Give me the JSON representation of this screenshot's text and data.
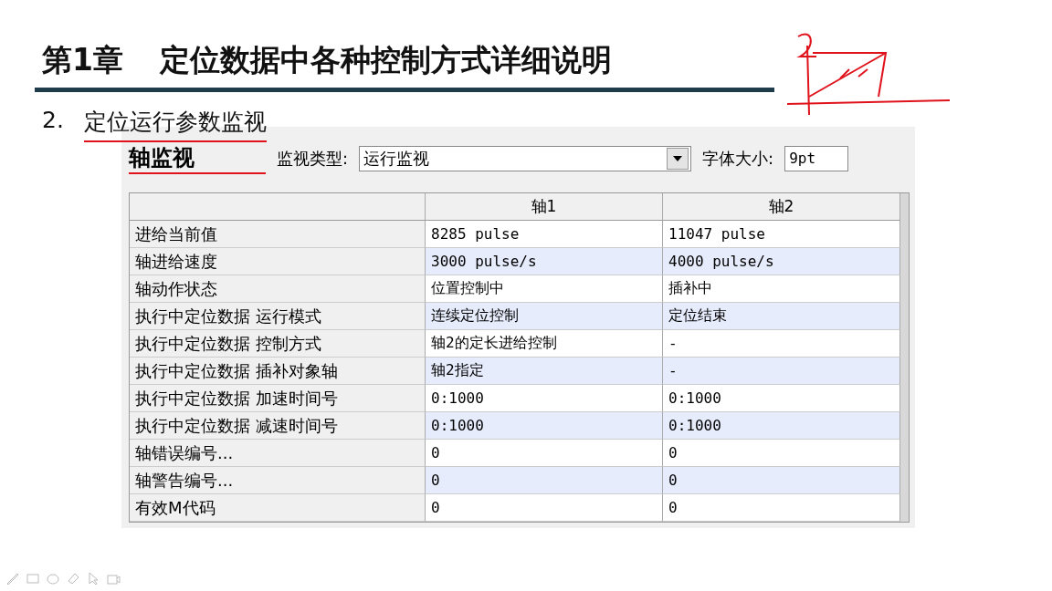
{
  "slide": {
    "chapter": "第1章",
    "title": "定位数据中各种控制方式详细说明",
    "section_number": "2.",
    "section_title": "定位运行参数监视"
  },
  "monitor": {
    "title": "轴监视",
    "type_label": "监视类型:",
    "type_value": "运行监视",
    "font_label": "字体大小:",
    "font_value": "9pt",
    "columns": [
      "轴1",
      "轴2"
    ],
    "rows": [
      {
        "label": "进给当前值",
        "values": [
          "8285 pulse",
          "11047 pulse"
        ]
      },
      {
        "label": "轴进给速度",
        "values": [
          "3000 pulse/s",
          "4000 pulse/s"
        ]
      },
      {
        "label": "轴动作状态",
        "values": [
          "位置控制中",
          "插补中"
        ]
      },
      {
        "label": "执行中定位数据 运行模式",
        "values": [
          "连续定位控制",
          "定位结束"
        ]
      },
      {
        "label": "执行中定位数据 控制方式",
        "values": [
          "轴2的定长进给控制",
          "-"
        ]
      },
      {
        "label": "执行中定位数据 插补对象轴",
        "values": [
          "轴2指定",
          "-"
        ]
      },
      {
        "label": "执行中定位数据 加速时间号",
        "values": [
          "0:1000",
          "0:1000"
        ]
      },
      {
        "label": "执行中定位数据 减速时间号",
        "values": [
          "0:1000",
          "0:1000"
        ]
      },
      {
        "label": "轴错误编号...",
        "values": [
          "0",
          "0"
        ]
      },
      {
        "label": "轴警告编号...",
        "values": [
          "0",
          "0"
        ]
      },
      {
        "label": "有效M代码",
        "values": [
          "0",
          "0"
        ]
      }
    ]
  }
}
